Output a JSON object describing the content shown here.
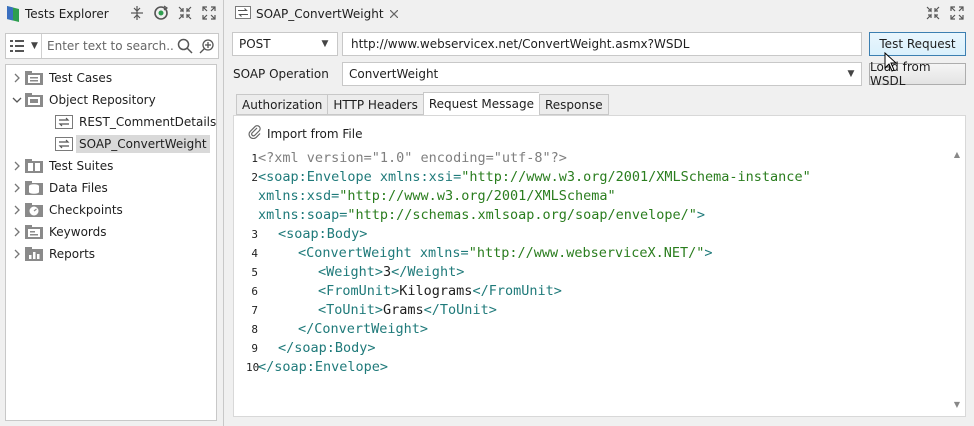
{
  "explorer": {
    "title": "Tests Explorer",
    "search_placeholder": "Enter text to search...",
    "tree": [
      {
        "label": "Test Cases",
        "icon": "test-cases-folder-icon",
        "expanded": false
      },
      {
        "label": "Object Repository",
        "icon": "object-repository-folder-icon",
        "expanded": true
      },
      {
        "label": "REST_CommentDetails",
        "icon": "web-service-request-icon",
        "child": true
      },
      {
        "label": "SOAP_ConvertWeight",
        "icon": "web-service-request-icon",
        "child": true,
        "selected": true
      },
      {
        "label": "Test Suites",
        "icon": "test-suites-folder-icon",
        "expanded": false
      },
      {
        "label": "Data Files",
        "icon": "data-files-folder-icon",
        "expanded": false
      },
      {
        "label": "Checkpoints",
        "icon": "checkpoints-folder-icon",
        "expanded": false
      },
      {
        "label": "Keywords",
        "icon": "keywords-folder-icon",
        "expanded": false
      },
      {
        "label": "Reports",
        "icon": "reports-folder-icon",
        "expanded": false
      }
    ]
  },
  "editor": {
    "tab_title": "SOAP_ConvertWeight",
    "method": "POST",
    "url": "http://www.webservicex.net/ConvertWeight.asmx?WSDL",
    "test_request_label": "Test Request",
    "soap_operation_label": "SOAP Operation",
    "soap_operation_value": "ConvertWeight",
    "load_from_wsdl_label": "Load from WSDL",
    "tabs": [
      "Authorization",
      "HTTP Headers",
      "Request Message",
      "Response"
    ],
    "active_tab": "Request Message",
    "import_label": "Import from File"
  },
  "code": {
    "line_numbers": [
      "1",
      "2",
      "3",
      "4",
      "5",
      "6",
      "7",
      "8",
      "9",
      "10"
    ],
    "l1": "<?xml version=\"1.0\" encoding=\"utf-8\"?>",
    "l2a_tag": "<soap:Envelope xmlns:xsi=",
    "l2a_str": "\"http://www.w3.org/2001/XMLSchema-instance\"",
    "l2b_tag": "xmlns:xsd=",
    "l2b_str": "\"http://www.w3.org/2001/XMLSchema\"",
    "l2c_tag": "xmlns:soap=",
    "l2c_str": "\"http://schemas.xmlsoap.org/soap/envelope/\"",
    "l2c_end": ">",
    "l3": "<soap:Body>",
    "l4_tag": "<ConvertWeight xmlns=",
    "l4_str": "\"http://www.webserviceX.NET/\"",
    "l4_end": ">",
    "l5_open": "<Weight>",
    "l5_val": "3",
    "l5_close": "</Weight>",
    "l6_open": "<FromUnit>",
    "l6_val": "Kilograms",
    "l6_close": "</FromUnit>",
    "l7_open": "<ToUnit>",
    "l7_val": "Grams",
    "l7_close": "</ToUnit>",
    "l8": "</ConvertWeight>",
    "l9": "</soap:Body>",
    "l10": "</soap:Envelope>"
  },
  "colors": {
    "xml_declaration": "#7f7f7f",
    "xml_tag": "#1f7a7a",
    "xml_string": "#2a7d1e",
    "selection": "#d9d9d9",
    "primary_button_border": "#3c7fb1"
  }
}
